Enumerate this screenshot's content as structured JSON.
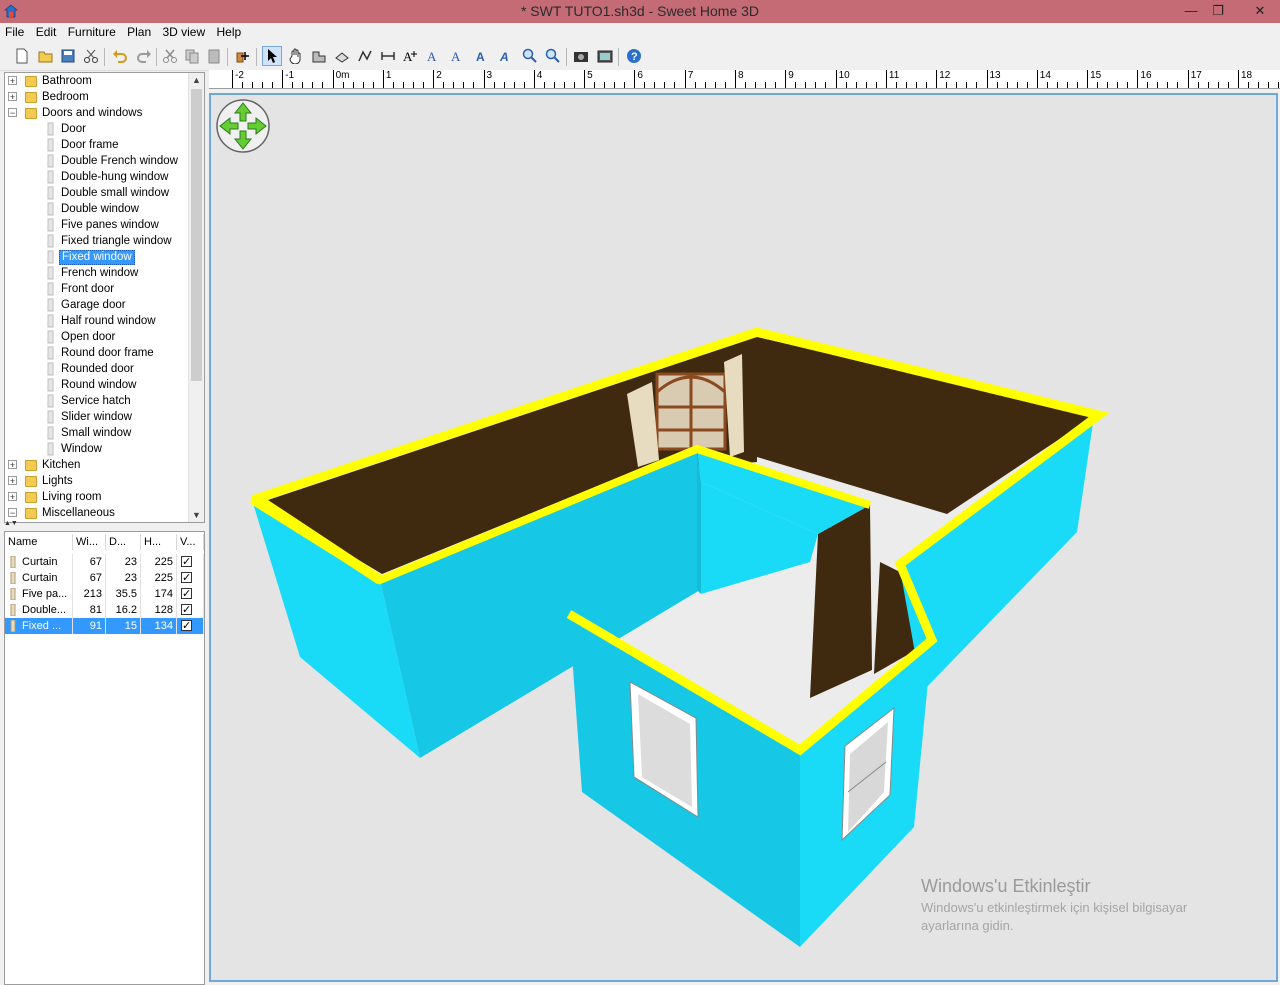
{
  "window": {
    "title": "* SWT TUTO1.sh3d - Sweet Home 3D",
    "controls": {
      "minimize": "—",
      "restore": "❐",
      "close": "✕"
    }
  },
  "menu": [
    "File",
    "Edit",
    "Furniture",
    "Plan",
    "3D view",
    "Help"
  ],
  "toolbar": {
    "buttons": [
      "new-home-icon",
      "open-icon",
      "save-icon",
      "cut-scissors-icon",
      "undo-icon",
      "redo-icon",
      "cut-icon",
      "copy-icon",
      "paste-icon",
      "add-furniture-icon",
      "select-mode-icon",
      "pan-mode-icon",
      "create-walls-icon",
      "create-rooms-icon",
      "create-polylines-icon",
      "create-dimensions-icon",
      "add-text-icon",
      "text-style-icon",
      "increase-text-icon",
      "decrease-text-icon",
      "italic-text-icon",
      "zoom-in-icon",
      "zoom-out-icon",
      "create-photo-icon",
      "create-video-icon",
      "help-icon"
    ],
    "active": "select-mode-icon"
  },
  "catalog": {
    "categories_top": [
      {
        "label": "Bathroom",
        "expanded": false
      },
      {
        "label": "Bedroom",
        "expanded": false
      },
      {
        "label": "Doors and windows",
        "expanded": true
      }
    ],
    "items": [
      "Door",
      "Door frame",
      "Double French window",
      "Double-hung window",
      "Double small window",
      "Double window",
      "Five panes window",
      "Fixed triangle window",
      "Fixed window",
      "French window",
      "Front door",
      "Garage door",
      "Half round window",
      "Open door",
      "Round door frame",
      "Rounded door",
      "Round window",
      "Service hatch",
      "Slider window",
      "Small window",
      "Window"
    ],
    "selected_item": "Fixed window",
    "categories_bottom": [
      {
        "label": "Kitchen",
        "expanded": false
      },
      {
        "label": "Lights",
        "expanded": false
      },
      {
        "label": "Living room",
        "expanded": false
      },
      {
        "label": "Miscellaneous",
        "expanded": true
      }
    ]
  },
  "furniture_table": {
    "headers": [
      "Name",
      "Wi...",
      "D...",
      "H...",
      "V..."
    ],
    "rows": [
      {
        "name": "Curtain",
        "width": "67",
        "depth": "23",
        "height": "225",
        "visible": true
      },
      {
        "name": "Curtain",
        "width": "67",
        "depth": "23",
        "height": "225",
        "visible": true
      },
      {
        "name": "Five pa...",
        "width": "213",
        "depth": "35.5",
        "height": "174",
        "visible": true
      },
      {
        "name": "Double...",
        "width": "81",
        "depth": "16.2",
        "height": "128",
        "visible": true
      },
      {
        "name": "Fixed ...",
        "width": "91",
        "depth": "15",
        "height": "134",
        "visible": true
      }
    ],
    "selected_row": 4
  },
  "ruler": {
    "labels": [
      "-2",
      "-1",
      "0m",
      "1",
      "2",
      "3",
      "4",
      "5",
      "6",
      "7",
      "8",
      "9",
      "10",
      "11",
      "12",
      "13",
      "14",
      "15",
      "16",
      "17",
      "18"
    ]
  },
  "view3d": {
    "colors": {
      "wall_outer": "#19dbf8",
      "wall_shade": "#10b9d6",
      "wall_top": "#ffff00",
      "wall_inner": "#3f2a10",
      "floor": "#ececec",
      "background": "#e4e4e4"
    },
    "navigator": "navigation-arrows-icon"
  },
  "watermark": {
    "title": "Windows'u Etkinleştir",
    "line1": "Windows'u etkinleştirmek için kişisel bilgisayar",
    "line2": "ayarlarına gidin."
  }
}
